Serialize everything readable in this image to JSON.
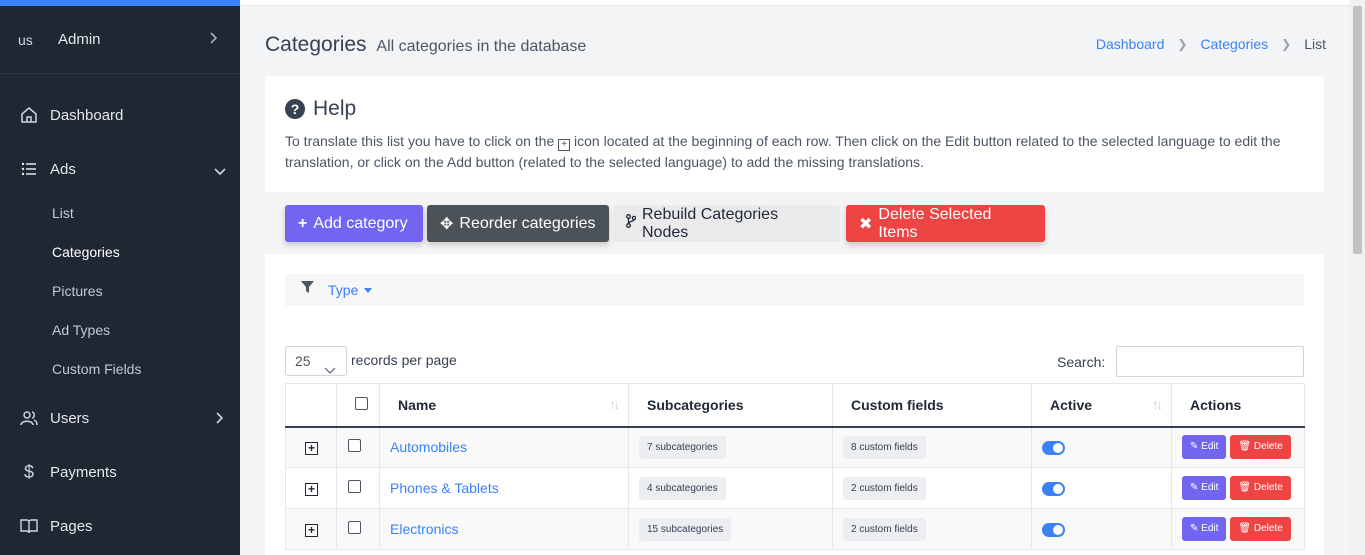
{
  "sidebar": {
    "user": {
      "avatar_alt": "us",
      "name": "Admin"
    },
    "items": [
      {
        "label": "Dashboard"
      },
      {
        "label": "Ads"
      },
      {
        "label": "Users"
      },
      {
        "label": "Payments"
      },
      {
        "label": "Pages"
      }
    ],
    "ads_sub": [
      {
        "label": "List"
      },
      {
        "label": "Categories"
      },
      {
        "label": "Pictures"
      },
      {
        "label": "Ad Types"
      },
      {
        "label": "Custom Fields"
      }
    ]
  },
  "header": {
    "title": "Categories",
    "subtitle": "All categories in the database",
    "breadcrumb": [
      "Dashboard",
      "Categories",
      "List"
    ]
  },
  "help": {
    "title": "Help",
    "text_before": "To translate this list you have to click on the",
    "text_after": "icon located at the beginning of each row. Then click on the Edit button related to the selected language to edit the translation, or click on the Add button (related to the selected language) to add the missing translations."
  },
  "toolbar": {
    "add": "Add category",
    "reorder": "Reorder categories",
    "rebuild": "Rebuild Categories Nodes",
    "delete": "Delete Selected Items"
  },
  "filter": {
    "type_label": "Type"
  },
  "table_controls": {
    "per_page_value": "25",
    "per_page_label": "records per page",
    "search_label": "Search:"
  },
  "table": {
    "columns": [
      "Name",
      "Subcategories",
      "Custom fields",
      "Active",
      "Actions"
    ],
    "rows": [
      {
        "name": "Automobiles",
        "subcategories": "7 subcategories",
        "custom_fields": "8 custom fields",
        "active": true
      },
      {
        "name": "Phones & Tablets",
        "subcategories": "4 subcategories",
        "custom_fields": "2 custom fields",
        "active": true
      },
      {
        "name": "Electronics",
        "subcategories": "15 subcategories",
        "custom_fields": "2 custom fields",
        "active": true
      }
    ],
    "edit_label": "Edit",
    "delete_label": "Delete"
  },
  "colors": {
    "primary": "#7266f0",
    "danger": "#ef4444",
    "link": "#3b82f6",
    "sidebar": "#1f2733"
  }
}
